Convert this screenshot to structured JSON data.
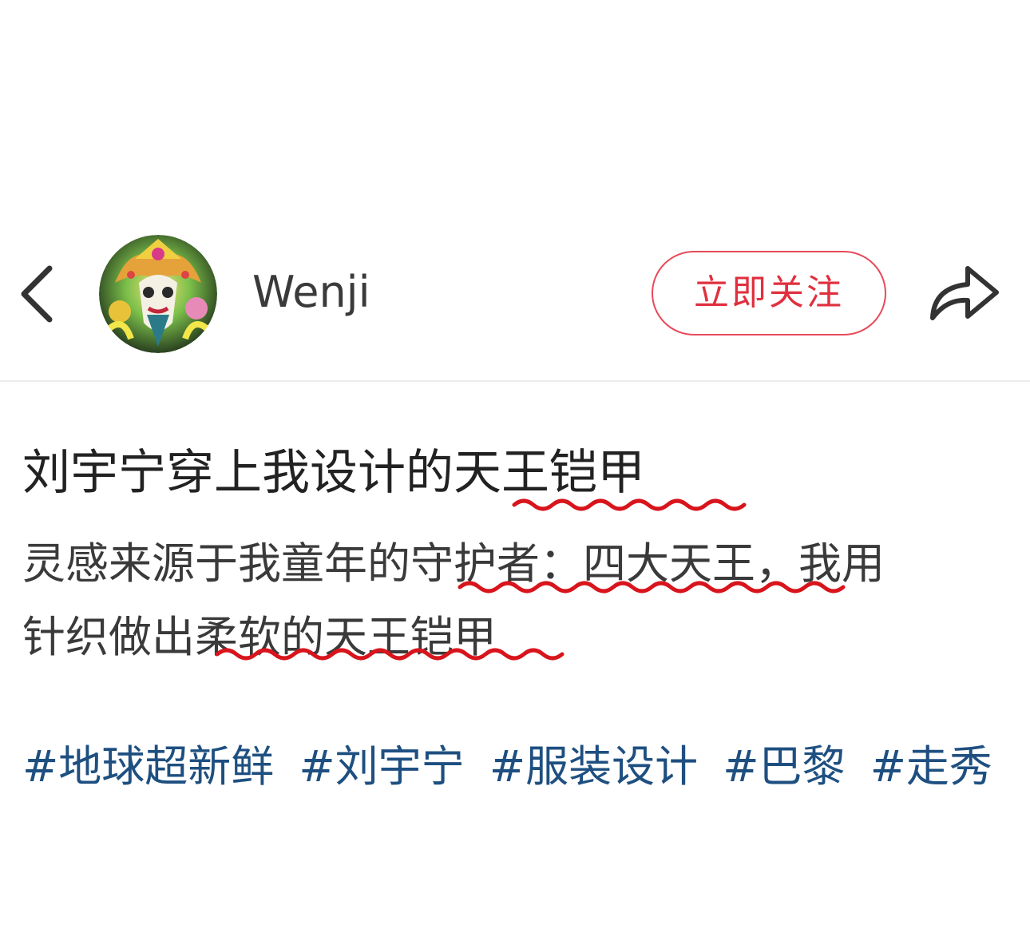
{
  "header": {
    "back_icon": "chevron-left-icon",
    "avatar_alt": "Wenji",
    "username": "Wenji",
    "follow_label": "立即关注",
    "share_icon": "share-arrow-icon",
    "colors": {
      "accent": "#e0303e",
      "text": "#3a3a3a"
    }
  },
  "post": {
    "title": "刘宇宁穿上我设计的天王铠甲",
    "body_line1": "灵感来源于我童年的守护者：四大天王，我用",
    "body_line2": "针织做出柔软的天王铠甲",
    "annotation_color": "#d8141c"
  },
  "tags": [
    "#地球超新鲜",
    "#刘宇宁",
    "#服装设计",
    "#巴黎",
    "#走秀"
  ],
  "tag_color": "#1e4f80"
}
